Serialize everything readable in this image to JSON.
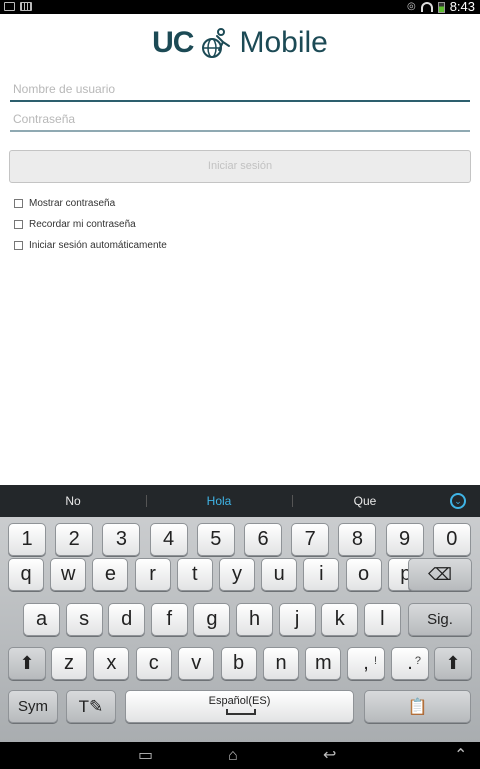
{
  "status_bar": {
    "time": "8:43",
    "icons": [
      "image-icon",
      "keyboard-icon",
      "eye-icon",
      "wifi-icon",
      "battery-icon"
    ]
  },
  "logo": {
    "left": "UC",
    "right": "Mobile",
    "color": "#1c4a55"
  },
  "form": {
    "username_placeholder": "Nombre de usuario",
    "username_value": "",
    "password_placeholder": "Contraseña",
    "password_value": "",
    "login_button": "Iniciar sesión",
    "options": [
      {
        "label": "Mostrar contraseña",
        "checked": false
      },
      {
        "label": "Recordar mi contraseña",
        "checked": false
      },
      {
        "label": "Iniciar sesión automáticamente",
        "checked": false
      }
    ]
  },
  "keyboard": {
    "suggestions": [
      "No",
      "Hola",
      "Que"
    ],
    "row_numbers": [
      "1",
      "2",
      "3",
      "4",
      "5",
      "6",
      "7",
      "8",
      "9",
      "0"
    ],
    "row_top": [
      "q",
      "w",
      "e",
      "r",
      "t",
      "y",
      "u",
      "i",
      "o",
      "p"
    ],
    "row_middle": [
      "a",
      "s",
      "d",
      "f",
      "g",
      "h",
      "j",
      "k",
      "l"
    ],
    "row_bottom": [
      "z",
      "x",
      "c",
      "v",
      "b",
      "n",
      "m"
    ],
    "comma": ",",
    "comma_alt": "!",
    "period": ".",
    "period_alt": "?",
    "next_key": "Sig.",
    "sym_key": "Sym",
    "language": "Español(ES)",
    "accent_color": "#3fb4e6"
  }
}
